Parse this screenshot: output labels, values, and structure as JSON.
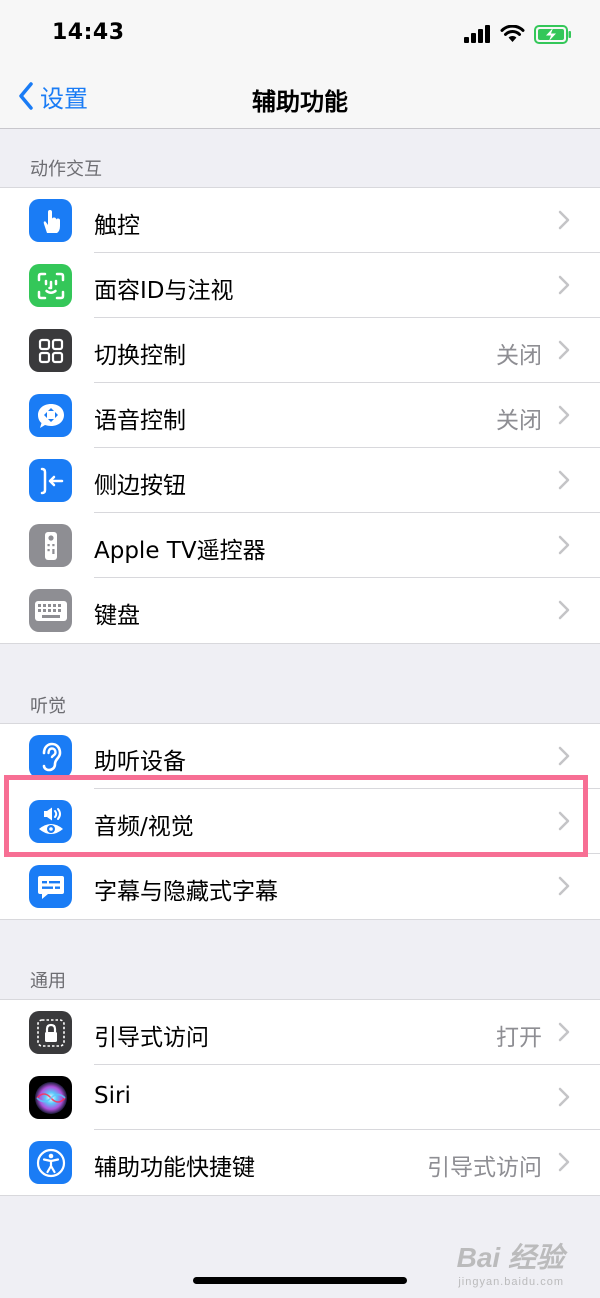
{
  "status_bar": {
    "time": "14:43"
  },
  "nav": {
    "back_label": "设置",
    "title": "辅助功能"
  },
  "sections": [
    {
      "header": "动作交互",
      "items": [
        {
          "label": "触控",
          "value": "",
          "icon": "hand-touch-icon",
          "color": "#1a7cf5"
        },
        {
          "label": "面容ID与注视",
          "value": "",
          "icon": "face-id-icon",
          "color": "#34c759"
        },
        {
          "label": "切换控制",
          "value": "关闭",
          "icon": "switch-control-icon",
          "color": "#3a3a3c"
        },
        {
          "label": "语音控制",
          "value": "关闭",
          "icon": "voice-control-icon",
          "color": "#1a7cf5"
        },
        {
          "label": "侧边按钮",
          "value": "",
          "icon": "side-button-icon",
          "color": "#1a7cf5"
        },
        {
          "label": "Apple TV遥控器",
          "value": "",
          "icon": "tv-remote-icon",
          "color": "#8e8e93"
        },
        {
          "label": "键盘",
          "value": "",
          "icon": "keyboard-icon",
          "color": "#8e8e93"
        }
      ]
    },
    {
      "header": "听觉",
      "items": [
        {
          "label": "助听设备",
          "value": "",
          "icon": "ear-icon",
          "color": "#1a7cf5"
        },
        {
          "label": "音频/视觉",
          "value": "",
          "icon": "audio-visual-icon",
          "color": "#1a7cf5"
        },
        {
          "label": "字幕与隐藏式字幕",
          "value": "",
          "icon": "captions-icon",
          "color": "#1a7cf5"
        }
      ]
    },
    {
      "header": "通用",
      "items": [
        {
          "label": "引导式访问",
          "value": "打开",
          "icon": "guided-access-lock-icon",
          "color": "#3a3a3c"
        },
        {
          "label": "Siri",
          "value": "",
          "icon": "siri-icon",
          "color": "#000000"
        },
        {
          "label": "辅助功能快捷键",
          "value": "引导式访问",
          "icon": "accessibility-icon",
          "color": "#1a7cf5"
        }
      ]
    }
  ],
  "watermark": {
    "main": "Bai 经验",
    "sub": "jingyan.baidu.com"
  }
}
